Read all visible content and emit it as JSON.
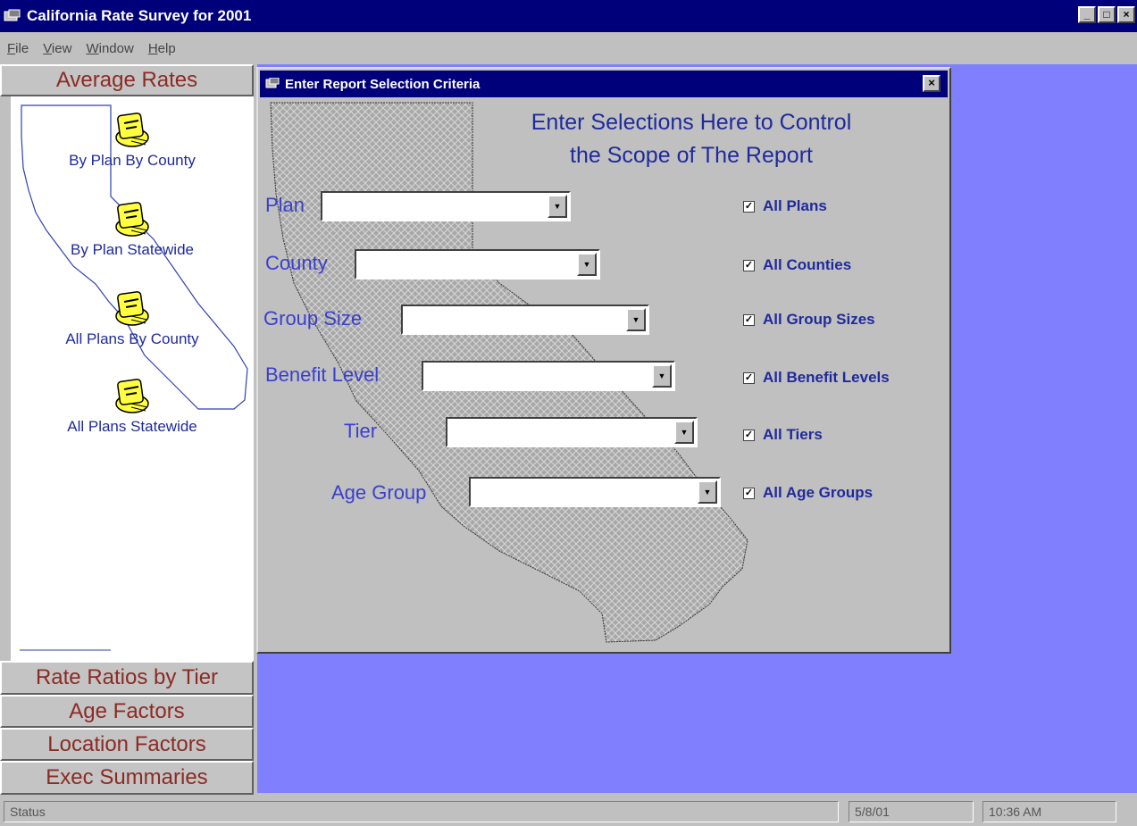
{
  "window": {
    "title": "California Rate Survey for 2001",
    "buttons": [
      "_",
      "□",
      "×"
    ]
  },
  "menu": [
    "File",
    "View",
    "Window",
    "Help"
  ],
  "nav": {
    "average_rates": "Average Rates",
    "reports": [
      {
        "label": "By Plan By County",
        "icon": "report-book-icon"
      },
      {
        "label": "By Plan Statewide",
        "icon": "report-book-icon"
      },
      {
        "label": "All Plans By County",
        "icon": "report-book-icon"
      },
      {
        "label": "All Plans Statewide",
        "icon": "report-book-icon"
      }
    ],
    "rate_ratios": "Rate Ratios by Tier",
    "age_factors": "Age Factors",
    "location_factors": "Location Factors",
    "exec_summaries": "Exec Summaries"
  },
  "dialog": {
    "title": "Enter Report Selection Criteria",
    "heading_line1": "Enter Selections Here to Control",
    "heading_line2": "the Scope of The Report",
    "fields": [
      {
        "label": "Plan",
        "value": "",
        "check_label": "All Plans",
        "checked": true
      },
      {
        "label": "County",
        "value": "",
        "check_label": "All Counties",
        "checked": true
      },
      {
        "label": "Group Size",
        "value": "",
        "check_label": "All Group Sizes",
        "checked": true
      },
      {
        "label": "Benefit Level",
        "value": "",
        "check_label": "All Benefit Levels",
        "checked": true
      },
      {
        "label": "Tier",
        "value": "",
        "check_label": "All Tiers",
        "checked": true
      },
      {
        "label": "Age Group",
        "value": "",
        "check_label": "All Age Groups",
        "checked": true
      }
    ]
  },
  "status": {
    "text": "Status",
    "date": "5/8/01",
    "time": "10:36 AM"
  },
  "colors": {
    "title_bar": "#00007b",
    "mdi_background": "#8080ff",
    "nav_text": "#8b2b24",
    "label_text": "#3a3fcc"
  }
}
